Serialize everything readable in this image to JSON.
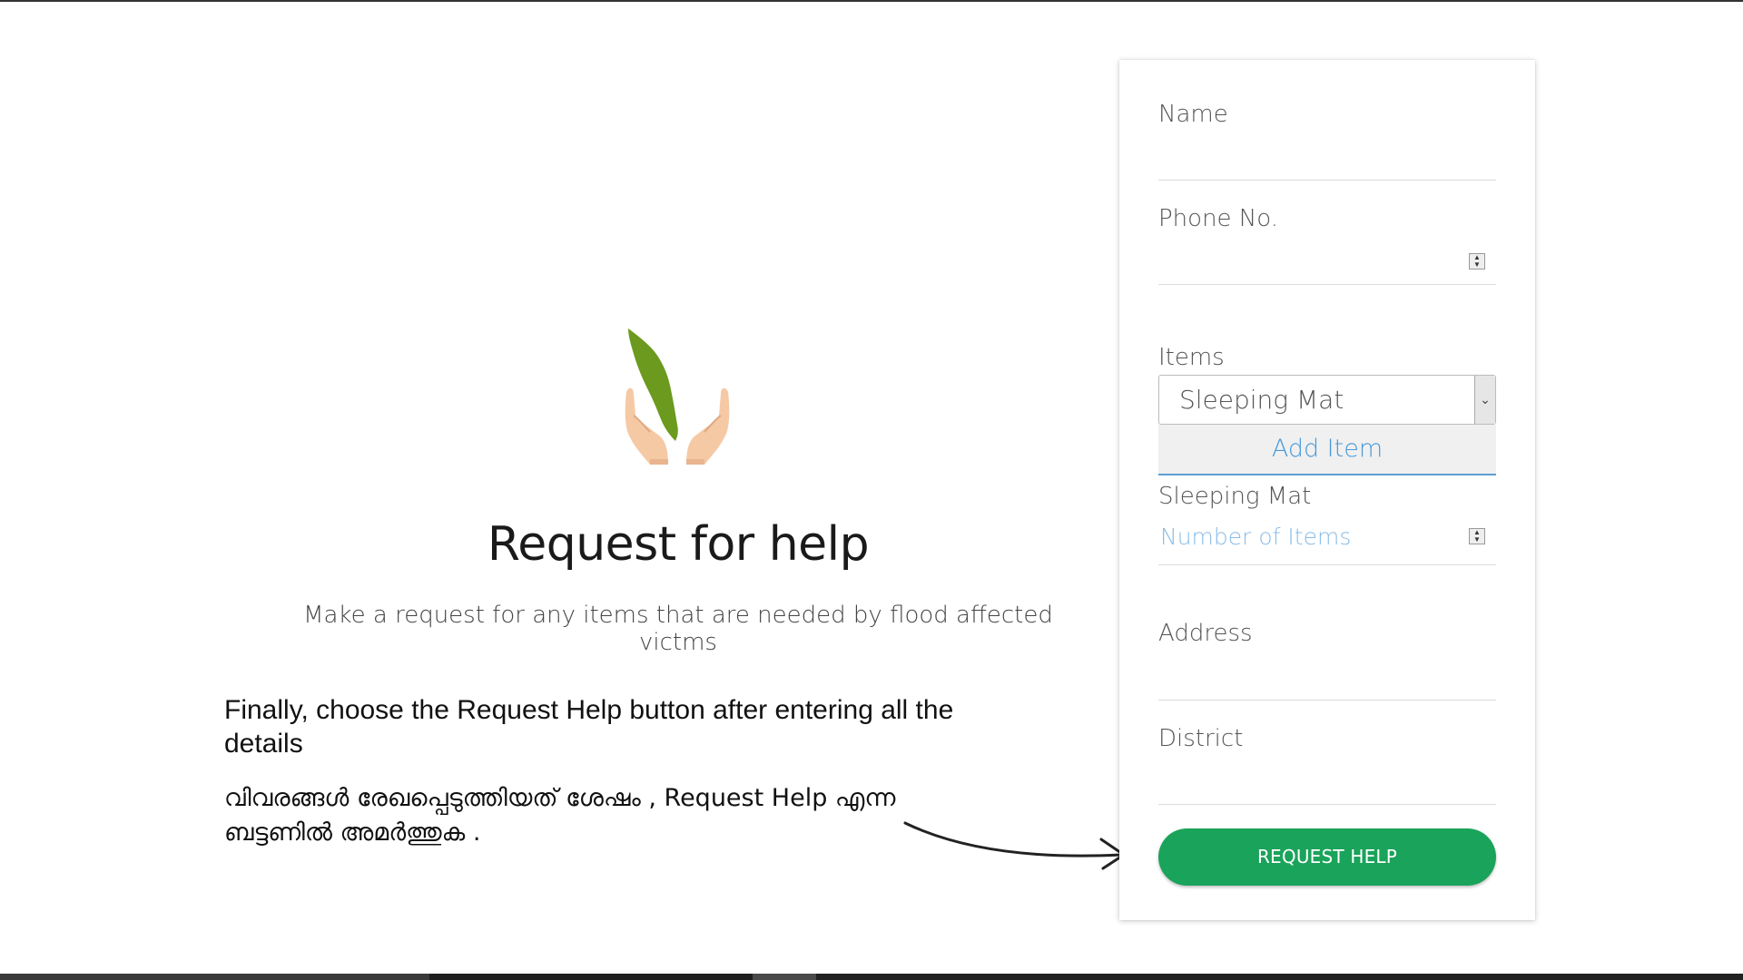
{
  "hero": {
    "title": "Request for help",
    "subtitle": "Make a request for any items that are needed by flood affected victms"
  },
  "instruction": {
    "english": "Finally, choose the Request Help button after entering all the details",
    "malayalam": "വിവരങ്ങൾ രേഖപ്പെടുത്തിയത് ശേഷം , Request Help എന്ന ബട്ടണിൽ അമർത്തുക ."
  },
  "form": {
    "name_label": "Name",
    "phone_label": "Phone No.",
    "items_label": "Items",
    "items_selected": "Sleeping Mat",
    "add_item_label": "Add Item",
    "added_item_name": "Sleeping Mat",
    "quantity_placeholder": "Number of Items",
    "address_label": "Address",
    "district_label": "District",
    "submit_label": "REQUEST HELP"
  },
  "colors": {
    "submit_button": "#1aa35a",
    "link_blue": "#4a9ad8",
    "logo_green": "#6b9a1e",
    "logo_hands": "#f6c9a5"
  },
  "icons": [
    "hands-leaf-logo",
    "chevron-down-icon",
    "spinner-icon",
    "arrow-icon"
  ]
}
